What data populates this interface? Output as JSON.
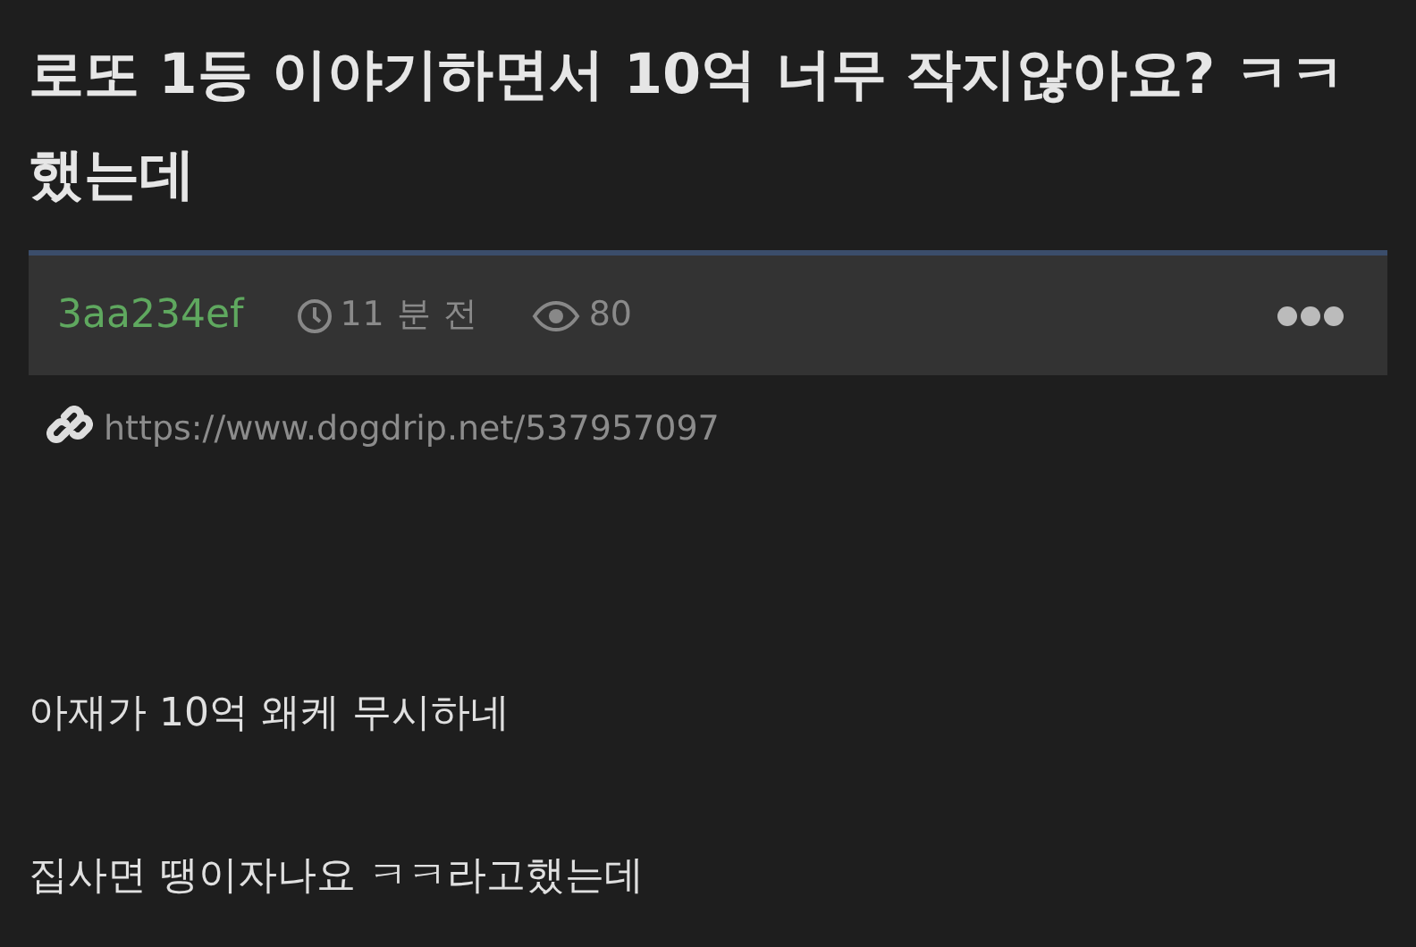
{
  "post": {
    "title": "로또 1등 이야기하면서 10억 너무 작지않아요? ㅋㅋ했는데",
    "meta": {
      "author": "3aa234ef",
      "time": "11 분 전",
      "views": "80"
    },
    "link": "https://www.dogdrip.net/537957097",
    "body": [
      "아재가 10억 왜케 무시하네",
      "집사면 땡이자나요 ㅋㅋ라고했는데"
    ]
  }
}
